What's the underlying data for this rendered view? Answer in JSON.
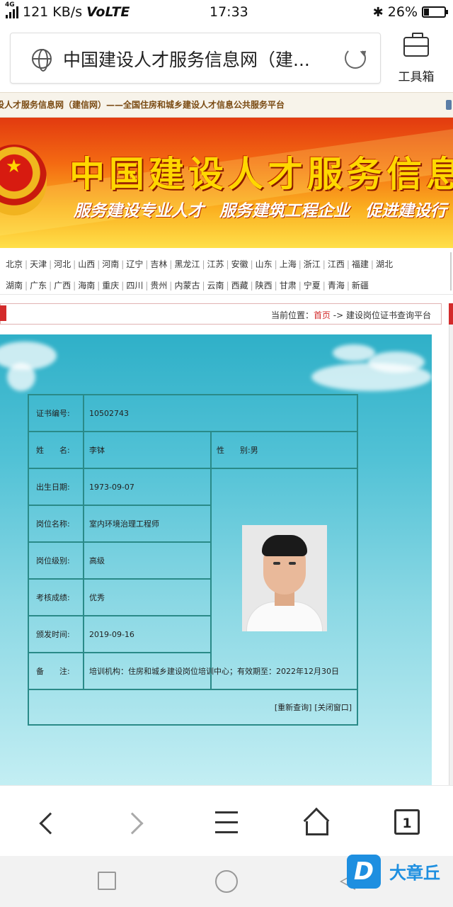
{
  "status_bar": {
    "network_type": "4G",
    "speed": "121 KB/s",
    "volte": "VoLTE",
    "time": "17:33",
    "battery_percent": "26%",
    "battery_level": 0.26
  },
  "browser": {
    "url_title": "中国建设人才服务信息网（建...",
    "toolbox_label": "工具箱"
  },
  "site": {
    "top_text": "设人才服务信息网（建信网）——全国住房和城乡建设人才信息公共服务平台",
    "banner_title": "中国建设人才服务信息",
    "banner_subtitle": "服务建设专业人才 服务建筑工程企业 促进建设行",
    "provinces_row1": [
      "北京",
      "天津",
      "河北",
      "山西",
      "河南",
      "辽宁",
      "吉林",
      "黑龙江",
      "江苏",
      "安徽",
      "山东",
      "上海",
      "浙江",
      "江西",
      "福建",
      "湖北"
    ],
    "provinces_row2": [
      "湖南",
      "广东",
      "广西",
      "海南",
      "重庆",
      "四川",
      "贵州",
      "内蒙古",
      "云南",
      "西藏",
      "陕西",
      "甘肃",
      "宁夏",
      "青海",
      "新疆"
    ],
    "location_prefix": "当前位置：",
    "location_home": "首页",
    "location_arrow": " -> ",
    "location_current": "建设岗位证书查询平台"
  },
  "certificate": {
    "cert_no_label": "证书编号:",
    "cert_no": "10502743",
    "name_label": "姓　　名:",
    "name": "李钵",
    "sex_label": "性　　别:",
    "sex": "男",
    "birth_label": "出生日期:",
    "birth": "1973-09-07",
    "position_label": "岗位名称:",
    "position": "室内环境治理工程师",
    "level_label": "岗位级别:",
    "level": "高级",
    "score_label": "考核成绩:",
    "score": "优秀",
    "issue_label": "颁发时间:",
    "issue": "2019-09-16",
    "remark_label": "备　　注:",
    "remark": "培训机构：住房和城乡建设岗位培训中心；有效期至：2022年12月30日",
    "requery": "[重新查询]",
    "close": "[关闭窗口]"
  },
  "bottom_nav": {
    "tabs_count": "1"
  },
  "watermark": {
    "logo": "D",
    "text": "大章丘"
  }
}
